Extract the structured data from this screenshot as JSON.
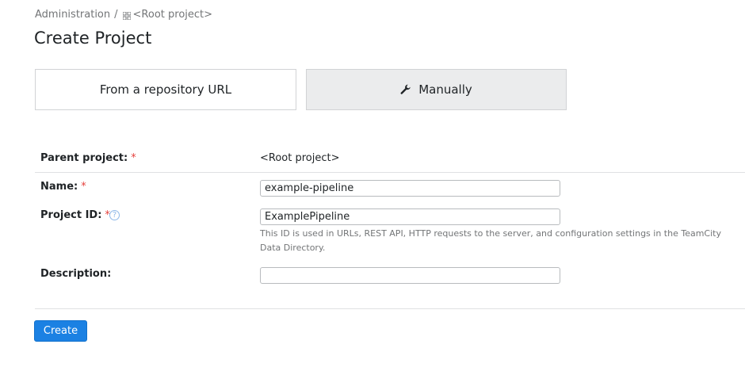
{
  "breadcrumb": {
    "admin": "Administration",
    "separator": "/",
    "root": "<Root project>"
  },
  "page": {
    "title": "Create Project"
  },
  "tabs": {
    "repo": "From a repository URL",
    "manual": "Manually"
  },
  "form": {
    "parent": {
      "label": "Parent project:",
      "required": "*",
      "value": "<Root project>"
    },
    "name": {
      "label": "Name:",
      "required": "*",
      "value": "example-pipeline"
    },
    "project_id": {
      "label": "Project ID:",
      "required": "*",
      "help_icon": "?",
      "value": "ExamplePipeline",
      "hint": "This ID is used in URLs, REST API, HTTP requests to the server, and configuration settings in the TeamCity Data Directory."
    },
    "description": {
      "label": "Description:",
      "value": ""
    }
  },
  "actions": {
    "create_label": "Create"
  },
  "colors": {
    "primary_button": "#1b81e3",
    "required_asterisk": "#e5413d",
    "selected_tab_bg": "#ebeced"
  },
  "icons": {
    "breadcrumb_project": "project-grid-icon",
    "manual_tab": "wrench-icon",
    "help": "question-circle-icon"
  }
}
